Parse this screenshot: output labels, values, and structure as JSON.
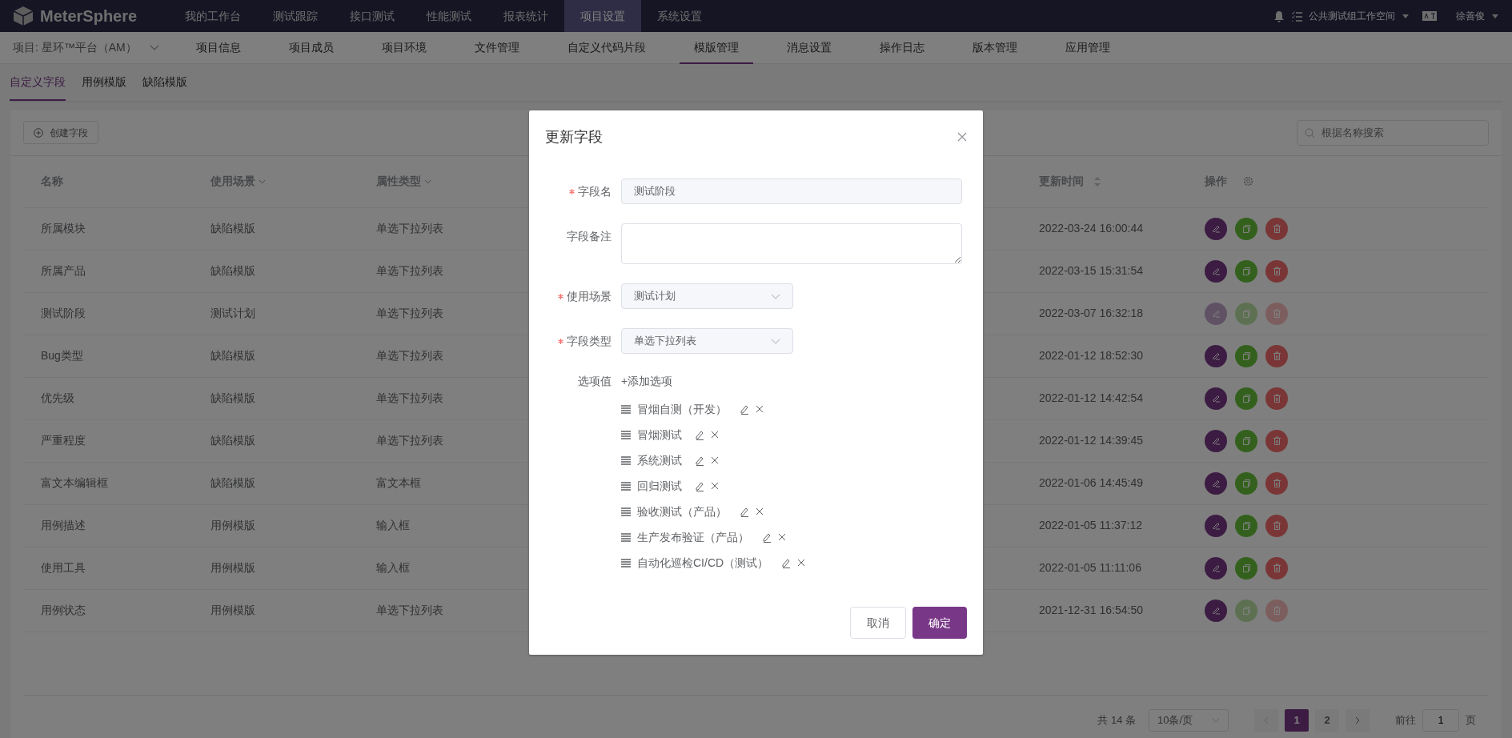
{
  "topbar": {
    "logo": "MeterSphere",
    "menu": [
      {
        "label": "我的工作台",
        "selected": false
      },
      {
        "label": "测试跟踪",
        "selected": false
      },
      {
        "label": "接口测试",
        "selected": false
      },
      {
        "label": "性能测试",
        "selected": false
      },
      {
        "label": "报表统计",
        "selected": false
      },
      {
        "label": "项目设置",
        "selected": true
      },
      {
        "label": "系统设置",
        "selected": false
      }
    ],
    "workspace": "公共测试组工作空间",
    "user": "徐善俊"
  },
  "subnav": {
    "project": "项目: 星环™平台（AM）",
    "items": [
      {
        "label": "项目信息",
        "selected": false
      },
      {
        "label": "项目成员",
        "selected": false
      },
      {
        "label": "项目环境",
        "selected": false
      },
      {
        "label": "文件管理",
        "selected": false
      },
      {
        "label": "自定义代码片段",
        "selected": false
      },
      {
        "label": "模版管理",
        "selected": true
      },
      {
        "label": "消息设置",
        "selected": false
      },
      {
        "label": "操作日志",
        "selected": false
      },
      {
        "label": "版本管理",
        "selected": false
      },
      {
        "label": "应用管理",
        "selected": false
      }
    ]
  },
  "tabs": [
    {
      "label": "自定义字段",
      "selected": true
    },
    {
      "label": "用例模版",
      "selected": false
    },
    {
      "label": "缺陷模版",
      "selected": false
    }
  ],
  "toolbar": {
    "create_button": "创建字段",
    "search": {
      "placeholder": "根据名称搜索"
    }
  },
  "table": {
    "columns": [
      {
        "label": "名称",
        "kind": "plain"
      },
      {
        "label": "使用场景",
        "kind": "filter"
      },
      {
        "label": "属性类型",
        "kind": "filter"
      },
      {
        "label": "更新时间",
        "kind": "sort"
      },
      {
        "label": "操作",
        "kind": "settings"
      }
    ],
    "rows": [
      {
        "name": "所属模块",
        "scene": "缺陷模版",
        "type": "单选下拉列表",
        "updated": "2022-03-24 16:00:44",
        "edit_disabled": false,
        "copy_disabled": false,
        "delete_disabled": false
      },
      {
        "name": "所属产品",
        "scene": "缺陷模版",
        "type": "单选下拉列表",
        "updated": "2022-03-15 15:31:54",
        "edit_disabled": false,
        "copy_disabled": false,
        "delete_disabled": false
      },
      {
        "name": "测试阶段",
        "scene": "测试计划",
        "type": "单选下拉列表",
        "updated": "2022-03-07 16:32:18",
        "edit_disabled": true,
        "copy_disabled": true,
        "delete_disabled": true
      },
      {
        "name": "Bug类型",
        "scene": "缺陷模版",
        "type": "单选下拉列表",
        "updated": "2022-01-12 18:52:30",
        "edit_disabled": false,
        "copy_disabled": false,
        "delete_disabled": false
      },
      {
        "name": "优先级",
        "scene": "缺陷模版",
        "type": "单选下拉列表",
        "updated": "2022-01-12 14:42:54",
        "edit_disabled": false,
        "copy_disabled": false,
        "delete_disabled": false
      },
      {
        "name": "严重程度",
        "scene": "缺陷模版",
        "type": "单选下拉列表",
        "updated": "2022-01-12 14:39:45",
        "edit_disabled": false,
        "copy_disabled": false,
        "delete_disabled": false
      },
      {
        "name": "富文本编辑框",
        "scene": "缺陷模版",
        "type": "富文本框",
        "updated": "2022-01-06 14:45:49",
        "edit_disabled": false,
        "copy_disabled": false,
        "delete_disabled": false
      },
      {
        "name": "用例描述",
        "scene": "用例模版",
        "type": "输入框",
        "updated": "2022-01-05 11:37:12",
        "edit_disabled": false,
        "copy_disabled": false,
        "delete_disabled": false
      },
      {
        "name": "使用工具",
        "scene": "用例模版",
        "type": "输入框",
        "updated": "2022-01-05 11:11:06",
        "edit_disabled": false,
        "copy_disabled": false,
        "delete_disabled": false
      },
      {
        "name": "用例状态",
        "scene": "用例模版",
        "type": "单选下拉列表",
        "updated": "2021-12-31 16:54:50",
        "edit_disabled": false,
        "copy_disabled": true,
        "delete_disabled": true
      }
    ]
  },
  "pagination": {
    "total": "共 14 条",
    "page_size": "10条/页",
    "pages": [
      {
        "label": "1",
        "selected": true
      },
      {
        "label": "2",
        "selected": false
      }
    ],
    "goto_label": "前往",
    "goto_value": "1",
    "page_unit": "页"
  },
  "dialog": {
    "title": "更新字段",
    "fields": [
      {
        "label": "字段名",
        "required": true,
        "kind": "input",
        "value": "测试阶段"
      },
      {
        "label": "字段备注",
        "required": false,
        "kind": "textarea"
      },
      {
        "label": "使用场景",
        "required": true,
        "kind": "select",
        "value": "测试计划"
      },
      {
        "label": "字段类型",
        "required": true,
        "kind": "select",
        "value": "单选下拉列表"
      }
    ],
    "options_label": "选项值",
    "add_option": "+添加选项",
    "options": [
      "冒烟自测（开发）",
      "冒烟测试",
      "系统测试",
      "回归测试",
      "验收测试（产品）",
      "生产发布验证（产品）",
      "自动化巡检CI/CD（测试）"
    ],
    "cancel": "取消",
    "confirm": "确定"
  }
}
